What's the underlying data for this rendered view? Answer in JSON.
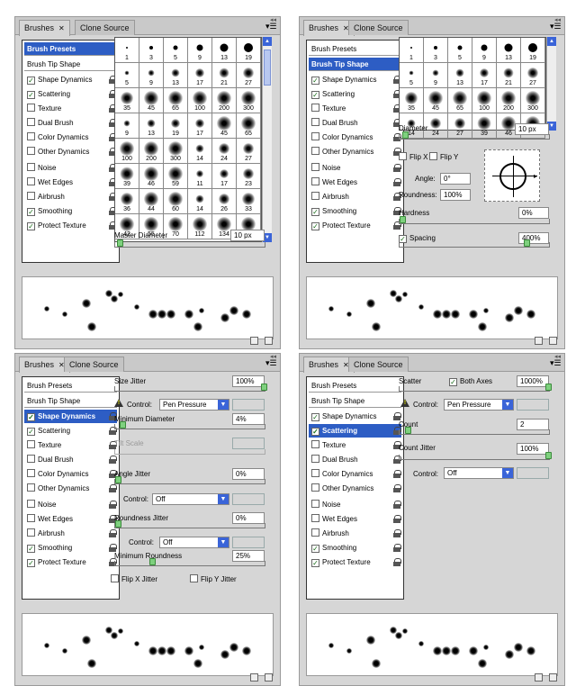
{
  "tabs": {
    "brushes": "Brushes",
    "clone": "Clone Source"
  },
  "list": {
    "presets": "Brush Presets",
    "tip": "Brush Tip Shape",
    "shape": "Shape Dynamics",
    "scattering": "Scattering",
    "texture": "Texture",
    "dual": "Dual Brush",
    "color": "Color Dynamics",
    "other": "Other Dynamics",
    "noise": "Noise",
    "wet": "Wet Edges",
    "airbrush": "Airbrush",
    "smoothing": "Smoothing",
    "protect": "Protect Texture"
  },
  "check_mark": "✓",
  "presets_grid_labels": [
    "1",
    "3",
    "5",
    "9",
    "13",
    "19",
    "5",
    "9",
    "13",
    "17",
    "21",
    "27",
    "35",
    "45",
    "65",
    "100",
    "200",
    "300",
    "9",
    "13",
    "19",
    "17",
    "45",
    "65",
    "100",
    "200",
    "300",
    "14",
    "24",
    "27",
    "39",
    "46",
    "59",
    "11",
    "17",
    "23",
    "36",
    "44",
    "60",
    "14",
    "26",
    "33",
    "42",
    "55",
    "70",
    "112",
    "134",
    "74"
  ],
  "tip_grid_labels": [
    "1",
    "3",
    "5",
    "9",
    "13",
    "19",
    "5",
    "9",
    "13",
    "17",
    "21",
    "27",
    "35",
    "45",
    "65",
    "100",
    "200",
    "300",
    "14",
    "24",
    "27",
    "39",
    "46",
    "59"
  ],
  "master_diameter": {
    "label": "Master Diameter",
    "value": "10 px"
  },
  "tip": {
    "diameter_label": "Diameter",
    "diameter_value": "10 px",
    "flipx": "Flip X",
    "flipy": "Flip Y",
    "angle_label": "Angle:",
    "angle_value": "0°",
    "round_label": "Roundness:",
    "round_value": "100%",
    "hardness_label": "Hardness",
    "hardness_value": "0%",
    "spacing_label": "Spacing",
    "spacing_value": "400%"
  },
  "shape": {
    "size_jitter": "Size Jitter",
    "size_jitter_value": "100%",
    "control": "Control:",
    "control_value": "Pen Pressure",
    "min_diam": "Minimum Diameter",
    "min_diam_value": "4%",
    "tilt": "Tilt Scale",
    "angle_jitter": "Angle Jitter",
    "angle_jitter_value": "0%",
    "control2_value": "Off",
    "round_jitter": "Roundness Jitter",
    "round_jitter_value": "0%",
    "control3_value": "Off",
    "min_round": "Minimum Roundness",
    "min_round_value": "25%",
    "flipx": "Flip X Jitter",
    "flipy": "Flip Y Jitter"
  },
  "scatter": {
    "scatter": "Scatter",
    "both": "Both Axes",
    "scatter_value": "1000%",
    "control": "Control:",
    "control_value": "Pen Pressure",
    "count": "Count",
    "count_value": "2",
    "count_jitter": "Count Jitter",
    "count_jitter_value": "100%",
    "control2_value": "Off"
  }
}
